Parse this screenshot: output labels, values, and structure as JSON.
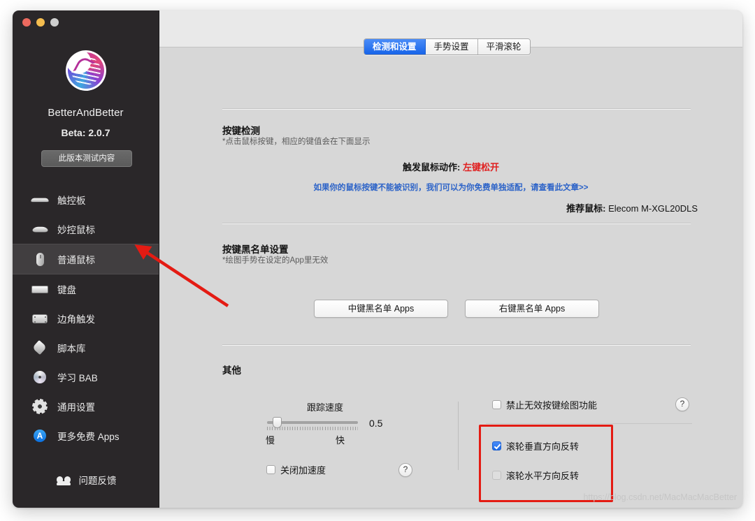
{
  "window": {
    "traffic_lights": [
      "close",
      "minimize",
      "maximize"
    ]
  },
  "sidebar": {
    "app_name": "BetterAndBetter",
    "version": "Beta:  2.0.7",
    "beta_notes_label": "此版本测试内容",
    "logo_icon": "betterandbetter-logo-icon",
    "items": [
      {
        "label": "触控板",
        "icon": "trackpad-icon",
        "active": false
      },
      {
        "label": "妙控鼠标",
        "icon": "magic-mouse-icon",
        "active": false
      },
      {
        "label": "普通鼠标",
        "icon": "mouse-icon",
        "active": true
      },
      {
        "label": "键盘",
        "icon": "keyboard-icon",
        "active": false
      },
      {
        "label": "边角触发",
        "icon": "hot-corner-icon",
        "active": false
      },
      {
        "label": "脚本库",
        "icon": "script-icon",
        "active": false
      },
      {
        "label": "学习 BAB",
        "icon": "learn-disc-icon",
        "active": false
      },
      {
        "label": "通用设置",
        "icon": "gear-icon",
        "active": false
      },
      {
        "label": "更多免费 Apps",
        "icon": "app-store-icon",
        "active": false
      }
    ],
    "feedback": {
      "label": "问题反馈",
      "icon": "feedback-people-icon"
    }
  },
  "tabs": [
    {
      "label": "检测和设置",
      "active": true
    },
    {
      "label": "手势设置",
      "active": false
    },
    {
      "label": "平滑滚轮",
      "active": false
    }
  ],
  "sections": {
    "key_detection": {
      "title": "按键检测",
      "subtitle": "*点击鼠标按键，相应的键值会在下面显示",
      "trigger_label": "触发鼠标动作:",
      "trigger_value": "左键松开",
      "trigger_value_color": "#e02020",
      "adapt_link": "如果你的鼠标按键不能被识别，我们可以为你免费单独适配，请查看此文章>>",
      "recommend_label": "推荐鼠标:",
      "recommend_value": "Elecom M-XGL20DLS"
    },
    "blacklist": {
      "title": "按键黑名单设置",
      "subtitle": "*绘图手势在设定的App里无效",
      "middle_button": "中键黑名单 Apps",
      "right_button": "右键黑名单 Apps"
    },
    "other": {
      "title": "其他",
      "slider": {
        "title": "跟踪速度",
        "min_label": "慢",
        "max_label": "快",
        "value": "0.5"
      },
      "disable_acceleration": {
        "label": "关闭加速度",
        "checked": false
      },
      "disable_invalid_draw": {
        "label": "禁止无效按键绘图功能",
        "checked": false
      },
      "scroll_vertical_invert": {
        "label": "滚轮垂直方向反转",
        "checked": true
      },
      "scroll_horizontal_invert": {
        "label": "滚轮水平方向反转",
        "checked": false
      },
      "help_icon": "?"
    }
  },
  "annotations": {
    "highlight_color": "#e41b13",
    "arrow_color": "#e41b13"
  },
  "watermark": "https://blog.csdn.net/MacMacMacBetter"
}
